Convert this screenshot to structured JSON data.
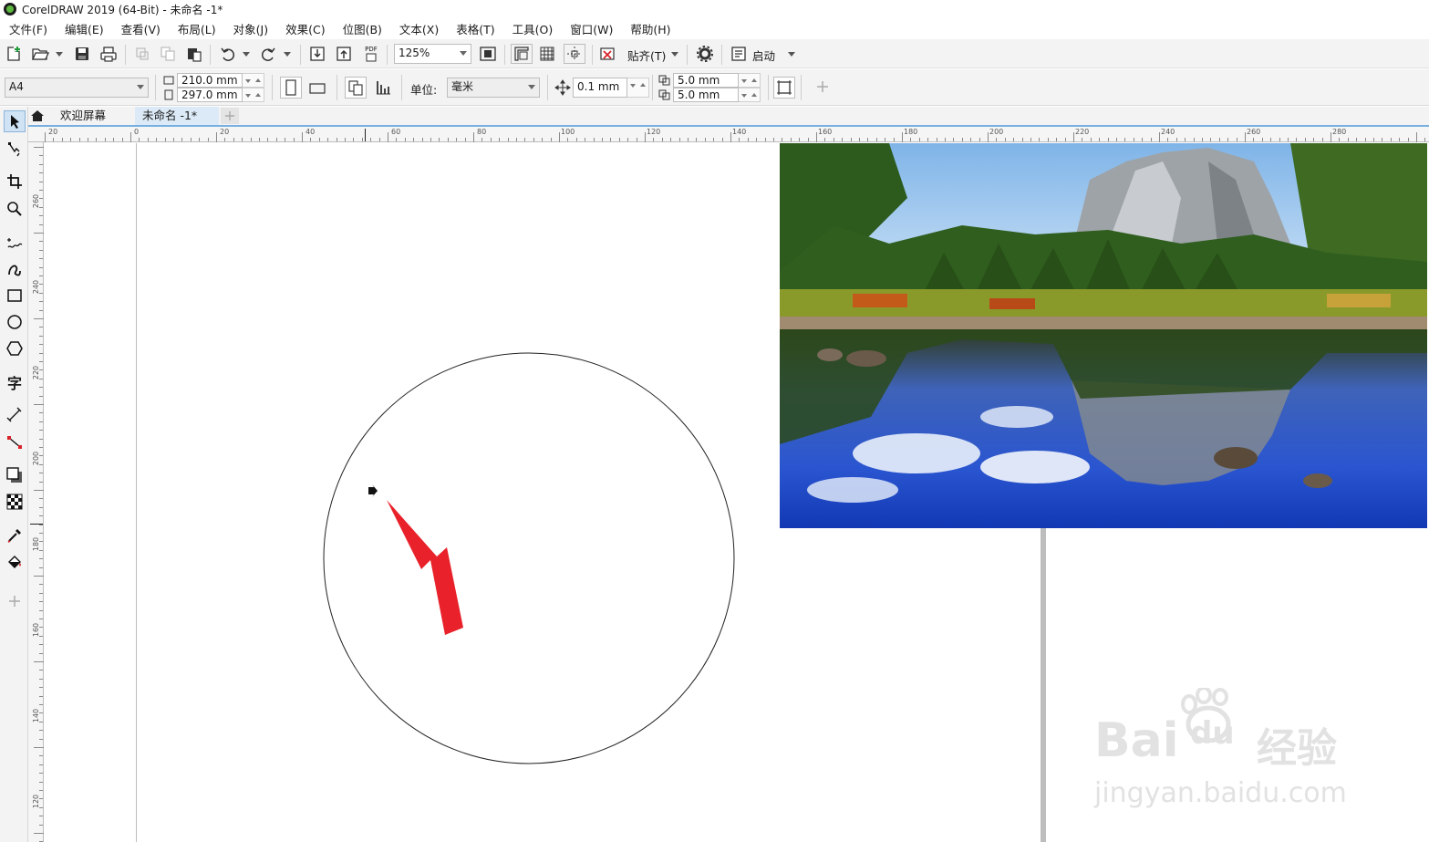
{
  "window": {
    "title": "CorelDRAW 2019 (64-Bit) - 未命名 -1*"
  },
  "menu": [
    "文件(F)",
    "编辑(E)",
    "查看(V)",
    "布局(L)",
    "对象(J)",
    "效果(C)",
    "位图(B)",
    "文本(X)",
    "表格(T)",
    "工具(O)",
    "窗口(W)",
    "帮助(H)"
  ],
  "toolbar": {
    "zoom": "125%",
    "pdf_label": "PDF",
    "snap_label": "贴齐(T)",
    "launch_label": "启动"
  },
  "propertybar": {
    "page_size": "A4",
    "width": "210.0 mm",
    "height": "297.0 mm",
    "units_label": "单位:",
    "units": "毫米",
    "nudge": "0.1 mm",
    "dup_x": "5.0 mm",
    "dup_y": "5.0 mm"
  },
  "tabs": {
    "welcome": "欢迎屏幕",
    "document": "未命名 -1*"
  },
  "ruler": {
    "h_labels": [
      "20",
      "0",
      "20",
      "40",
      "60",
      "80",
      "100",
      "120",
      "140",
      "160",
      "180",
      "200",
      "220",
      "240",
      "260",
      "280"
    ],
    "v_labels": [
      "260",
      "240",
      "220",
      "200",
      "180",
      "160",
      "140",
      "120"
    ]
  },
  "watermark": {
    "brand": "Bai",
    "brand2": "du",
    "cn": "经验",
    "url": "jingyan.baidu.com"
  },
  "colors": {
    "arrow": "#e8212a",
    "accent": "#76b0e0",
    "toolbar_bg": "#f3f3f3"
  },
  "icons": [
    "new-document-icon",
    "open-folder-icon",
    "save-icon",
    "print-icon",
    "undo-icon",
    "redo-icon",
    "import-icon",
    "export-icon",
    "settings-icon",
    "pick-tool-icon",
    "ellipse-tool-icon"
  ]
}
